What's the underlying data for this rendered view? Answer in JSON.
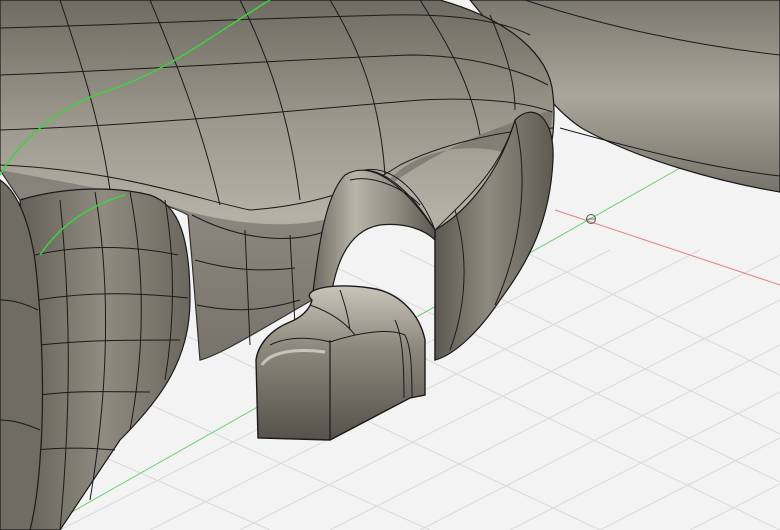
{
  "viewport": {
    "mode": "3d-tsplines-sculpt-model",
    "background": "#f3f3f3",
    "grid_color": "#d9d9d9",
    "axis_x_color": "#e08080",
    "axis_y_color": "#6ccf6c",
    "surface_color": "#7d7a70",
    "surface_highlight": "#b7b3a8",
    "edge_color": "#1a1a1a",
    "selected_edge_color": "#3fd23f",
    "icons": [
      "origin-point-icon"
    ]
  }
}
